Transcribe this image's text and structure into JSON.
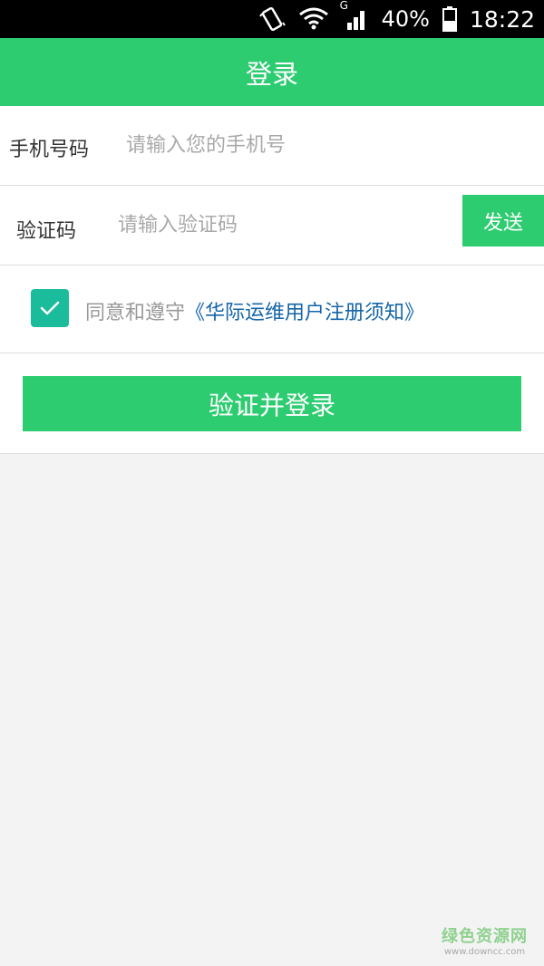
{
  "status_bar": {
    "battery_percent": "40%",
    "time": "18:22",
    "signal_type": "G",
    "icons": [
      "vibrate-icon",
      "wifi-icon",
      "signal-icon",
      "battery-icon"
    ]
  },
  "header": {
    "title": "登录"
  },
  "form": {
    "phone": {
      "label": "手机号码",
      "placeholder": "请输入您的手机号",
      "value": ""
    },
    "code": {
      "label": "验证码",
      "placeholder": "请输入验证码",
      "value": "",
      "send_label": "发送"
    },
    "agreement": {
      "checked": true,
      "prefix": "同意和遵守",
      "link_text": "《华际运维用户注册须知》"
    },
    "submit_label": "验证并登录"
  },
  "watermark": {
    "title": "绿色资源网",
    "url": "www.downcc.com"
  },
  "colors": {
    "accent": "#2ecc71",
    "checkbox": "#1abc9c",
    "link": "#1565a8",
    "background": "#f3f3f3"
  }
}
